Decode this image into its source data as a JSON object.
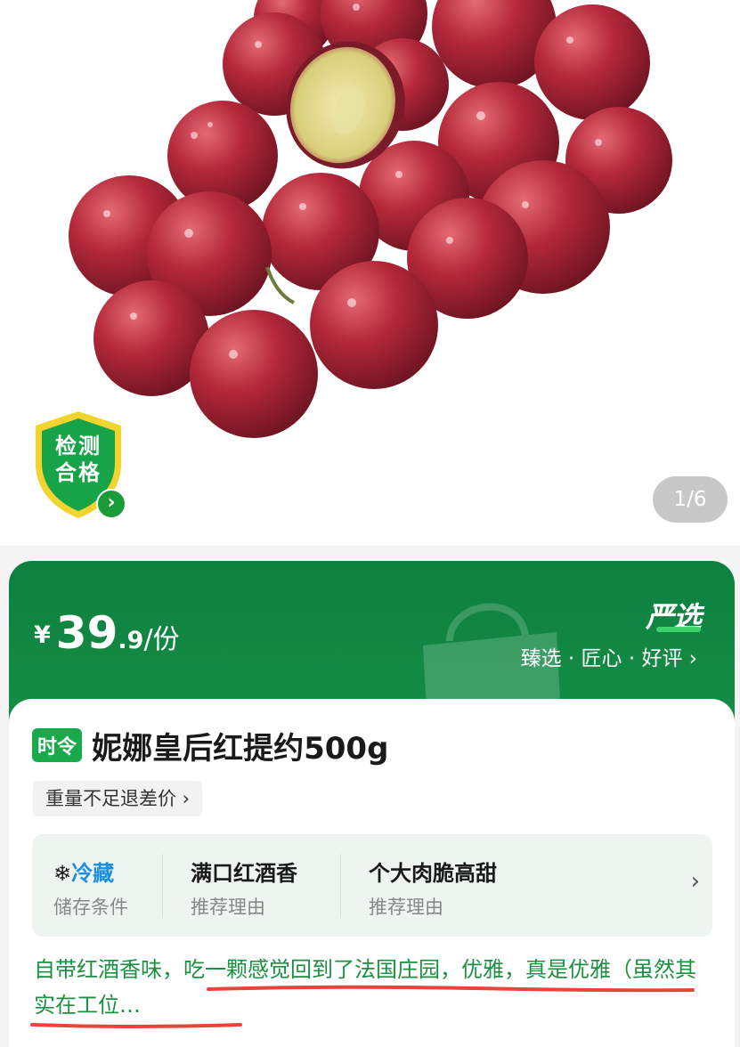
{
  "product_image": {
    "badge": {
      "line1": "检测",
      "line2": "合格",
      "arrow": "›"
    },
    "page_indicator": "1/6"
  },
  "price_banner": {
    "currency": "¥",
    "price_integer": "39",
    "price_decimal": ".9",
    "unit": "/份",
    "logo": "严选",
    "tagline": "臻选 · 匠心 · 好评 ›",
    "colors": {
      "banner": "#138a44",
      "logo_check": "#3dd16a"
    }
  },
  "product": {
    "season_tag": "时令",
    "title": "妮娜皇后红提约500g",
    "refund_tag": "重量不足退差价 ›"
  },
  "info": {
    "storage_icon": "snowflake-icon",
    "storage_value": "冷藏",
    "storage_label": "储存条件",
    "reason1": "满口红酒香",
    "reason1_label": "推荐理由",
    "reason2": "个大肉脆高甜",
    "reason2_label": "推荐理由",
    "chevron": "›"
  },
  "description": "自带红酒香味，吃一颗感觉回到了法国庄园，优雅，真是优雅（虽然其实在工位…",
  "annotation": {
    "color": "#e8453a"
  }
}
